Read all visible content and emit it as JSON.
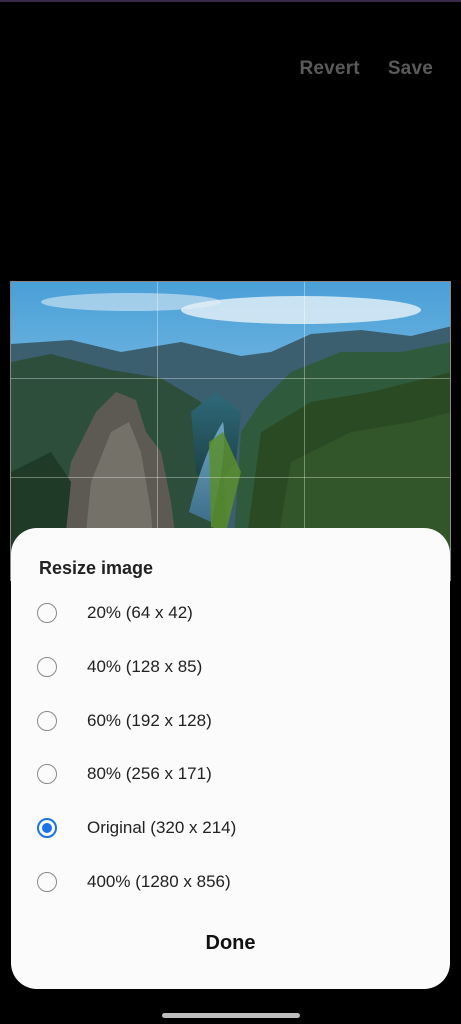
{
  "toolbar": {
    "revert_label": "Revert",
    "save_label": "Save"
  },
  "colors": {
    "accent": "#1a73e8",
    "sheet_background": "#fbfbfb",
    "screen_background": "#000000"
  },
  "dialog": {
    "title": "Resize image",
    "options": [
      {
        "label": "20% (64 x 42)",
        "selected": false
      },
      {
        "label": "40% (128 x 85)",
        "selected": false
      },
      {
        "label": "60% (192 x 128)",
        "selected": false
      },
      {
        "label": "80% (256 x 171)",
        "selected": false
      },
      {
        "label": "Original (320 x 214)",
        "selected": true
      },
      {
        "label": "400% (1280 x 856)",
        "selected": false
      }
    ],
    "done_label": "Done"
  },
  "image": {
    "subject": "mountain fjord landscape"
  }
}
